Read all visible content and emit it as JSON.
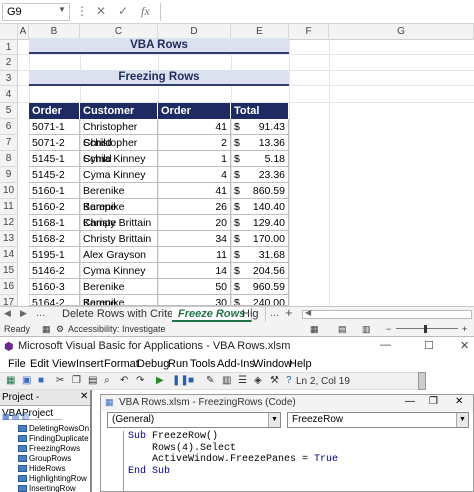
{
  "formula_bar": {
    "name_box": "G9",
    "cancel_icon": "✕",
    "enter_icon": "✓",
    "fx_label": "fx",
    "formula_value": ""
  },
  "columns": [
    "A",
    "B",
    "C",
    "D",
    "E",
    "F",
    "G"
  ],
  "rows": [
    "1",
    "2",
    "3",
    "4",
    "5",
    "6",
    "7",
    "8",
    "9",
    "10",
    "11",
    "12",
    "13",
    "14",
    "15",
    "16",
    "17"
  ],
  "sheet": {
    "title": "VBA Rows",
    "subtitle": "Freezing Rows",
    "headers": [
      "Order No",
      "Customer Name",
      "Order Quantity",
      "Total Price"
    ],
    "data": [
      [
        "5071-1",
        "Christopher Schild",
        "41",
        "$",
        "91.43"
      ],
      [
        "5071-2",
        "Christopher Schild",
        "2",
        "$",
        "13.36"
      ],
      [
        "5145-1",
        "Cyma Kinney",
        "1",
        "$",
        "5.18"
      ],
      [
        "5145-2",
        "Cyma Kinney",
        "4",
        "$",
        "23.36"
      ],
      [
        "5160-1",
        "Berenike Kampe",
        "41",
        "$",
        "860.59"
      ],
      [
        "5160-2",
        "Berenike Kampe",
        "26",
        "$",
        "140.40"
      ],
      [
        "5168-1",
        "Christy Brittain",
        "20",
        "$",
        "129.40"
      ],
      [
        "5168-2",
        "Christy Brittain",
        "34",
        "$",
        "170.00"
      ],
      [
        "5195-1",
        "Alex Grayson",
        "11",
        "$",
        "31.68"
      ],
      [
        "5146-2",
        "Cyma Kinney",
        "14",
        "$",
        "204.56"
      ],
      [
        "5160-3",
        "Berenike Kampe",
        "50",
        "$",
        "960.59"
      ],
      [
        "5164-2",
        "Berenike Kampe",
        "30",
        "$",
        "240.00"
      ]
    ]
  },
  "tabs": {
    "items": [
      "Delete Rows with Criteria",
      "Freeze Rows",
      "Hig"
    ],
    "active": "Freeze Rows",
    "more": "...",
    "add": "+"
  },
  "status": {
    "ready": "Ready",
    "accessibility": "Accessibility: Investigate"
  },
  "vba": {
    "window_title": "Microsoft Visual Basic for Applications - VBA Rows.xlsm",
    "menu": [
      "File",
      "Edit",
      "View",
      "Insert",
      "Format",
      "Debug",
      "Run",
      "Tools",
      "Add-Ins",
      "Window",
      "Help"
    ],
    "cursor_position": "Ln 2, Col 19",
    "project_title": "Project - VBAProject",
    "project_items": [
      "DeletingRowsOn",
      "FindingDuplicate",
      "FreezingRows",
      "GroupRows",
      "HideRows",
      "HighlightingRow",
      "InsertingRow"
    ],
    "code_title": "VBA Rows.xlsm - FreezingRows (Code)",
    "object_combo": "(General)",
    "proc_combo": "FreezeRow",
    "code_lines": [
      [
        "Sub ",
        "FreezeRow()"
      ],
      [
        "",
        "    Rows(4).Select"
      ],
      [
        "",
        "    ActiveWindow.FreezePanes = "
      ],
      [
        "End Sub",
        ""
      ]
    ],
    "code_true": "True"
  },
  "colors": {
    "header_fill": "#1f2a63",
    "title_fill": "#dce1f0",
    "active_tab": "#217346"
  }
}
